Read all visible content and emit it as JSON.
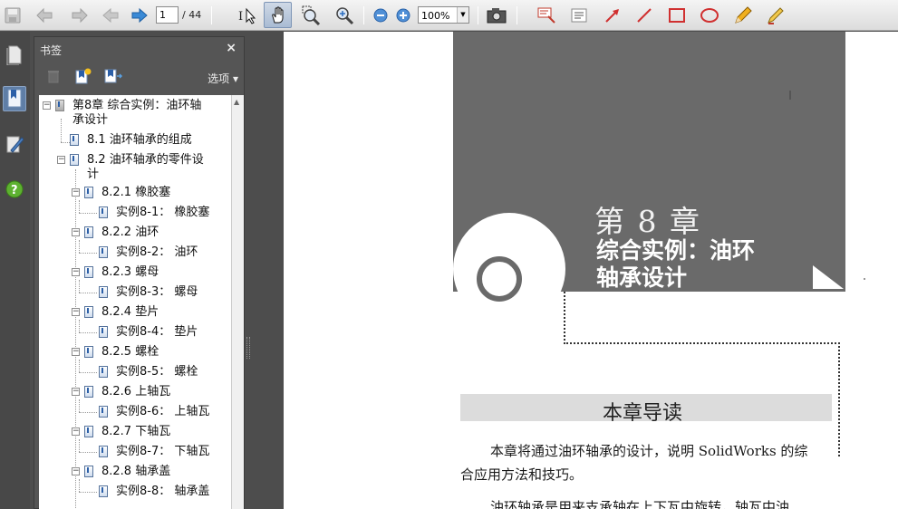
{
  "toolbar": {
    "page_number": "1",
    "page_total": "/ 44",
    "zoom": "100%",
    "icons": [
      "save-icon",
      "back-icon",
      "forward-icon",
      "previous-page-icon",
      "next-page-icon",
      "select-tool-icon",
      "hand-tool-icon",
      "marquee-zoom-icon",
      "dynamic-zoom-icon",
      "zoom-out-icon",
      "zoom-in-icon",
      "snapshot-icon",
      "note-icon",
      "text-edit-icon",
      "arrow-tool-icon",
      "line-tool-icon",
      "rectangle-tool-icon",
      "oval-tool-icon",
      "pencil-tool-icon",
      "highlighter-icon"
    ]
  },
  "rail": {
    "icons": [
      "pages-icon",
      "bookmarks-icon",
      "signatures-icon",
      "help-icon"
    ]
  },
  "bookmarks": {
    "title": "书签",
    "close": "×",
    "options": "选项 ▾",
    "items": [
      {
        "label": "第8章 综合实例：油环轴",
        "label2": "承设计"
      },
      {
        "label": "8.1 油环轴承的组成"
      },
      {
        "label": "8.2 油环轴承的零件设",
        "label2": "计"
      },
      {
        "label": "8.2.1 橡胶塞"
      },
      {
        "label": "实例8-1： 橡胶塞"
      },
      {
        "label": "8.2.2 油环"
      },
      {
        "label": "实例8-2： 油环"
      },
      {
        "label": "8.2.3 螺母"
      },
      {
        "label": "实例8-3： 螺母"
      },
      {
        "label": "8.2.4 垫片"
      },
      {
        "label": "实例8-4： 垫片"
      },
      {
        "label": "8.2.5 螺栓"
      },
      {
        "label": "实例8-5： 螺栓"
      },
      {
        "label": "8.2.6 上轴瓦"
      },
      {
        "label": "实例8-6： 上轴瓦"
      },
      {
        "label": "8.2.7 下轴瓦"
      },
      {
        "label": "实例8-7： 下轴瓦"
      },
      {
        "label": "8.2.8 轴承盖"
      },
      {
        "label": "实例8-8： 轴承盖"
      }
    ]
  },
  "document": {
    "chapter_number": "第 8 章",
    "chapter_title_1": "综合实例：油环",
    "chapter_title_2": "轴承设计",
    "guide_heading": "本章导读",
    "para_1a": "本章将通过油环轴承的设计，说明 SolidWorks 的综",
    "para_1b": "合应用方法和技巧。",
    "para_2": "油环轴承是用来支承轴在上下瓦中旋转，轴瓦中油"
  }
}
